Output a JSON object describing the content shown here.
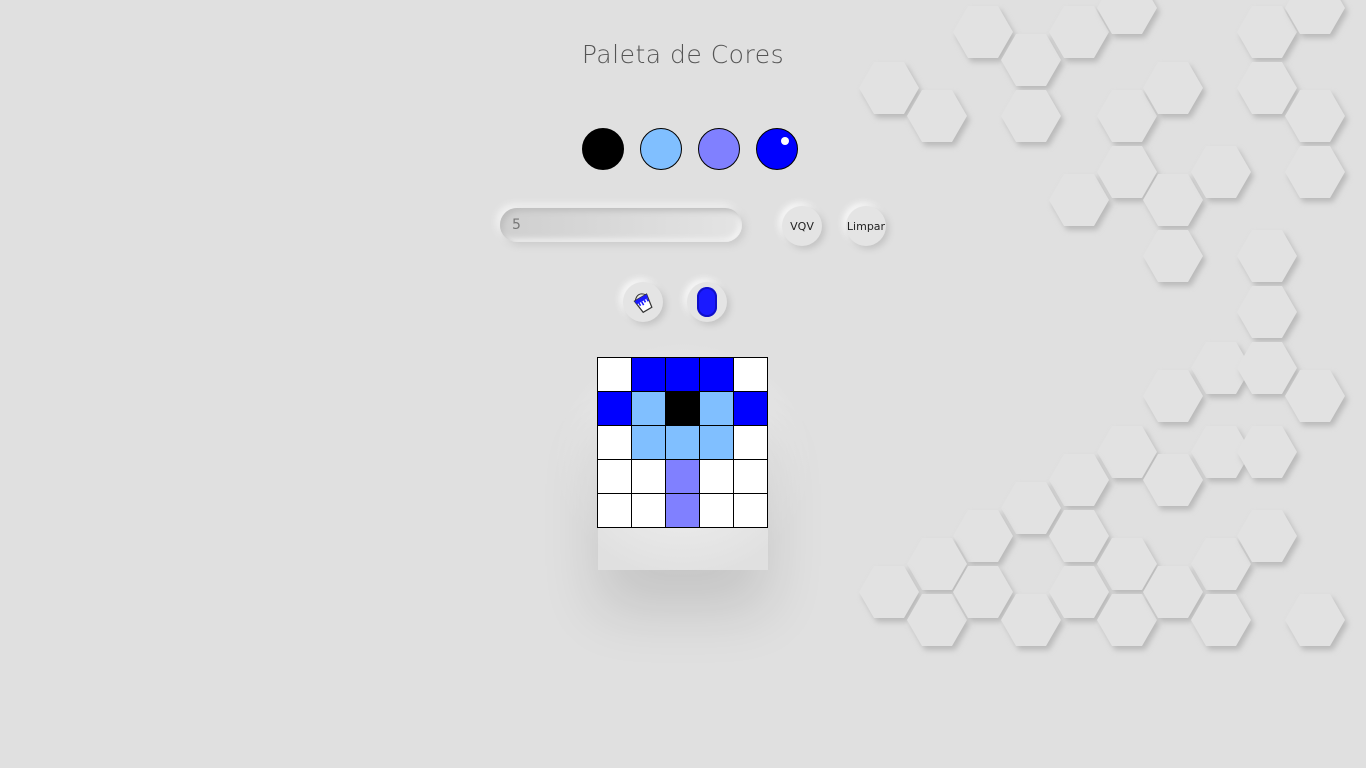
{
  "title": "Paleta de Cores",
  "palette": [
    {
      "name": "black",
      "color": "#000000",
      "selected": false
    },
    {
      "name": "light-blue",
      "color": "#80bfff",
      "selected": false
    },
    {
      "name": "lavender",
      "color": "#8080ff",
      "selected": false
    },
    {
      "name": "blue",
      "color": "#0000ff",
      "selected": true
    }
  ],
  "board_size_input": {
    "value": "",
    "placeholder": "5"
  },
  "buttons": {
    "vqv_label": "VQV",
    "clear_label": "Limpar"
  },
  "tools": {
    "bucket_icon": "paint-bucket-icon",
    "toggle_icon": "toggle-pill-icon",
    "toggle_color": "#1a1aff"
  },
  "board": {
    "size": 5,
    "pixels": [
      [
        "#ffffff",
        "#0000ff",
        "#0000ff",
        "#0000ff",
        "#ffffff"
      ],
      [
        "#0000ff",
        "#80bfff",
        "#000000",
        "#80bfff",
        "#0000ff"
      ],
      [
        "#ffffff",
        "#80bfff",
        "#80bfff",
        "#80bfff",
        "#ffffff"
      ],
      [
        "#ffffff",
        "#ffffff",
        "#8080ff",
        "#ffffff",
        "#ffffff"
      ],
      [
        "#ffffff",
        "#ffffff",
        "#8080ff",
        "#ffffff",
        "#ffffff"
      ]
    ]
  },
  "background": {
    "color": "#e0e0e0",
    "pattern": "hexagon-emboss"
  }
}
